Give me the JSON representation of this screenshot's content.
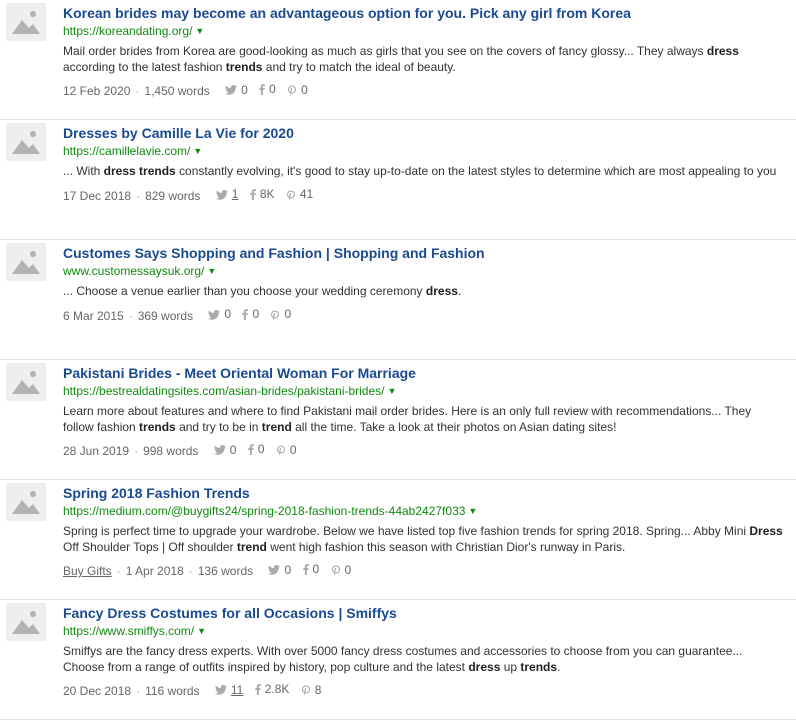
{
  "results": [
    {
      "title": "Korean brides may become an advantageous option for you. Pick any girl from Korea",
      "url": "https://koreandating.org/",
      "snippet": [
        {
          "t": "Mail order brides from Korea are good-looking as much as girls that you see on the covers of fancy glossy... They always ",
          "b": false
        },
        {
          "t": "dress",
          "b": true
        },
        {
          "t": " according to the latest fashion ",
          "b": false
        },
        {
          "t": "trends",
          "b": true
        },
        {
          "t": " and try to match the ideal of beauty.",
          "b": false
        }
      ],
      "author": "",
      "date": "12 Feb 2020",
      "words": "1,450 words",
      "twitter": "0",
      "facebook": "0",
      "pinterest": "0",
      "twitter_underline": false
    },
    {
      "title": "Dresses by Camille La Vie for 2020",
      "url": "https://camillelavie.com/",
      "snippet": [
        {
          "t": "... With ",
          "b": false
        },
        {
          "t": "dress trends",
          "b": true
        },
        {
          "t": " constantly evolving, it's good to stay up-to-date on the latest styles to determine which are most appealing to you",
          "b": false
        }
      ],
      "author": "",
      "date": "17 Dec 2018",
      "words": "829 words",
      "twitter": "1",
      "facebook": "8K",
      "pinterest": "41",
      "twitter_underline": true
    },
    {
      "title": "Customes Says Shopping and Fashion | Shopping and Fashion",
      "url": "www.customessaysuk.org/",
      "snippet": [
        {
          "t": "... Choose a venue earlier than you choose your wedding ceremony ",
          "b": false
        },
        {
          "t": "dress",
          "b": true
        },
        {
          "t": ".",
          "b": false
        }
      ],
      "author": "",
      "date": "6 Mar 2015",
      "words": "369 words",
      "twitter": "0",
      "facebook": "0",
      "pinterest": "0",
      "twitter_underline": false
    },
    {
      "title": "Pakistani Brides - Meet Oriental Woman For Marriage",
      "url": "https://bestrealdatingsites.com/asian-brides/pakistani-brides/",
      "snippet": [
        {
          "t": "Learn more about features and where to find Pakistani mail order brides. Here is an only full review with recommendations... They follow fashion ",
          "b": false
        },
        {
          "t": "trends",
          "b": true
        },
        {
          "t": " and try to be in ",
          "b": false
        },
        {
          "t": "trend",
          "b": true
        },
        {
          "t": " all the time. Take a look at their photos on Asian dating sites!",
          "b": false
        }
      ],
      "author": "",
      "date": "28 Jun 2019",
      "words": "998 words",
      "twitter": "0",
      "facebook": "0",
      "pinterest": "0",
      "twitter_underline": false
    },
    {
      "title": "Spring 2018 Fashion Trends",
      "url": "https://medium.com/@buygifts24/spring-2018-fashion-trends-44ab2427f033",
      "snippet": [
        {
          "t": "Spring is perfect time to upgrade your wardrobe. Below we have listed top five fashion trends for spring 2018. Spring... Abby Mini ",
          "b": false
        },
        {
          "t": "Dress",
          "b": true
        },
        {
          "t": " Off Shoulder Tops | Off shoulder ",
          "b": false
        },
        {
          "t": "trend",
          "b": true
        },
        {
          "t": " went high fashion this season with Christian Dior's runway in Paris.",
          "b": false
        }
      ],
      "author": "Buy Gifts",
      "date": "1 Apr 2018",
      "words": "136 words",
      "twitter": "0",
      "facebook": "0",
      "pinterest": "0",
      "twitter_underline": false
    },
    {
      "title": "Fancy Dress Costumes for all Occasions | Smiffys",
      "url": "https://www.smiffys.com/",
      "snippet": [
        {
          "t": "Smiffys are the fancy dress experts. With over 5000 fancy dress costumes and accessories to choose from you can guarantee... Choose from a range of outfits inspired by history, pop culture and the latest ",
          "b": false
        },
        {
          "t": "dress",
          "b": true
        },
        {
          "t": " up ",
          "b": false
        },
        {
          "t": "trends",
          "b": true
        },
        {
          "t": ".",
          "b": false
        }
      ],
      "author": "",
      "date": "20 Dec 2018",
      "words": "116 words",
      "twitter": "11",
      "facebook": "2.8K",
      "pinterest": "8",
      "twitter_underline": true
    }
  ],
  "meta_separator": "·",
  "caret_glyph": "▼",
  "colors": {
    "title": "#1a4a8f",
    "url": "#0f8a0f",
    "text": "#333333",
    "meta": "#666666",
    "divider": "#e3e3e3"
  }
}
